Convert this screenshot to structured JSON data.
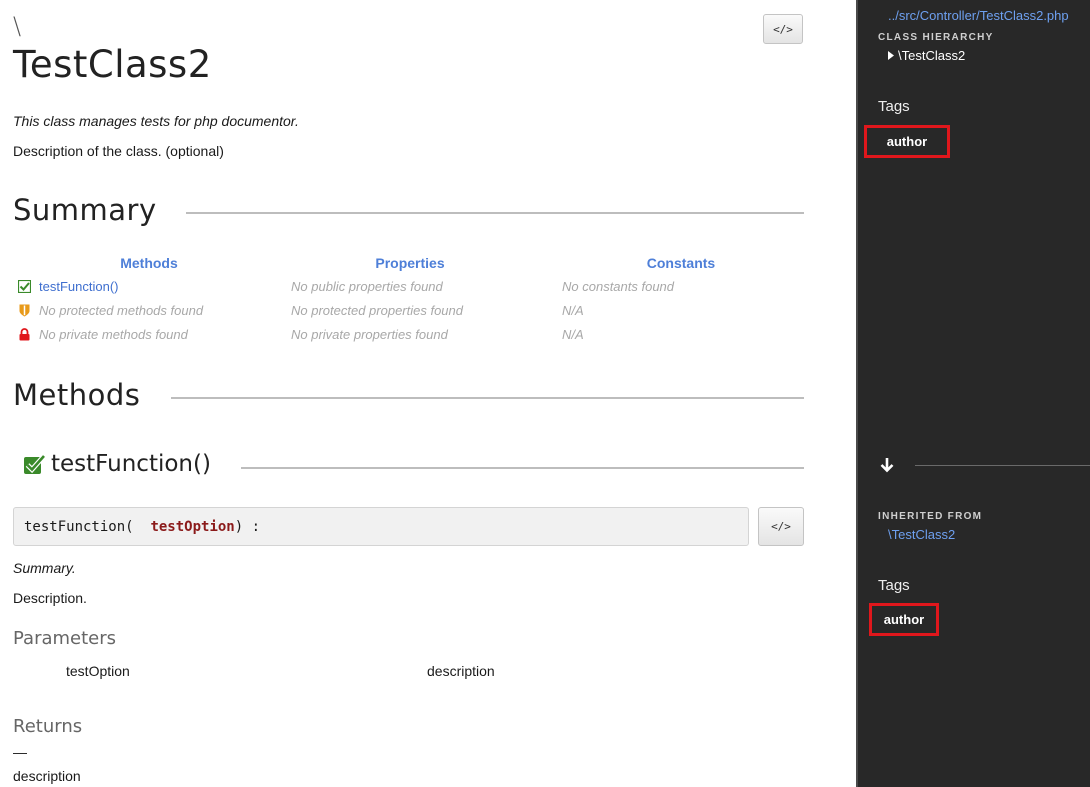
{
  "header": {
    "namespace": "\\",
    "class_name": "TestClass2",
    "source_button": "</>",
    "short_description": "This class manages tests for php documentor.",
    "long_description": "Description of the class. (optional)"
  },
  "summary": {
    "title": "Summary",
    "columns": [
      "Methods",
      "Properties",
      "Constants"
    ],
    "rows": [
      {
        "visibility": "public",
        "icon": "checkbox-icon",
        "methods": "testFunction()",
        "properties": "No public properties found",
        "constants": "No constants found"
      },
      {
        "visibility": "protected",
        "icon": "shield-icon",
        "methods": "No protected methods found",
        "properties": "No protected properties found",
        "constants": "N/A"
      },
      {
        "visibility": "private",
        "icon": "lock-icon",
        "methods": "No private methods found",
        "properties": "No private properties found",
        "constants": "N/A"
      }
    ]
  },
  "methods_section": {
    "title": "Methods",
    "method": {
      "name": "testFunction()",
      "signature_prefix": "testFunction(  ",
      "signature_param": "testOption",
      "signature_suffix": ") :",
      "source_button": "</>",
      "summary": "Summary.",
      "description": "Description.",
      "parameters_title": "Parameters",
      "parameters": [
        {
          "name": "testOption",
          "description": "description"
        }
      ],
      "returns_title": "Returns",
      "return_type": "—",
      "return_description": "description"
    }
  },
  "sidebar": {
    "file_path": "../src/Controller/TestClass2.php",
    "class_hierarchy_label": "CLASS HIERARCHY",
    "class_hierarchy_item": "\\TestClass2",
    "tags_title": "Tags",
    "tag": "author",
    "inherited_from_label": "INHERITED FROM",
    "inherited_from_link": "\\TestClass2",
    "method_tags_title": "Tags",
    "method_tag": "author"
  },
  "colors": {
    "link": "#3f6fcf",
    "sidebar_bg": "#282828",
    "highlight_box": "#e0171c",
    "public_icon": "#3a8a2a",
    "protected_icon": "#e89a1a",
    "private_icon": "#e0171c"
  }
}
